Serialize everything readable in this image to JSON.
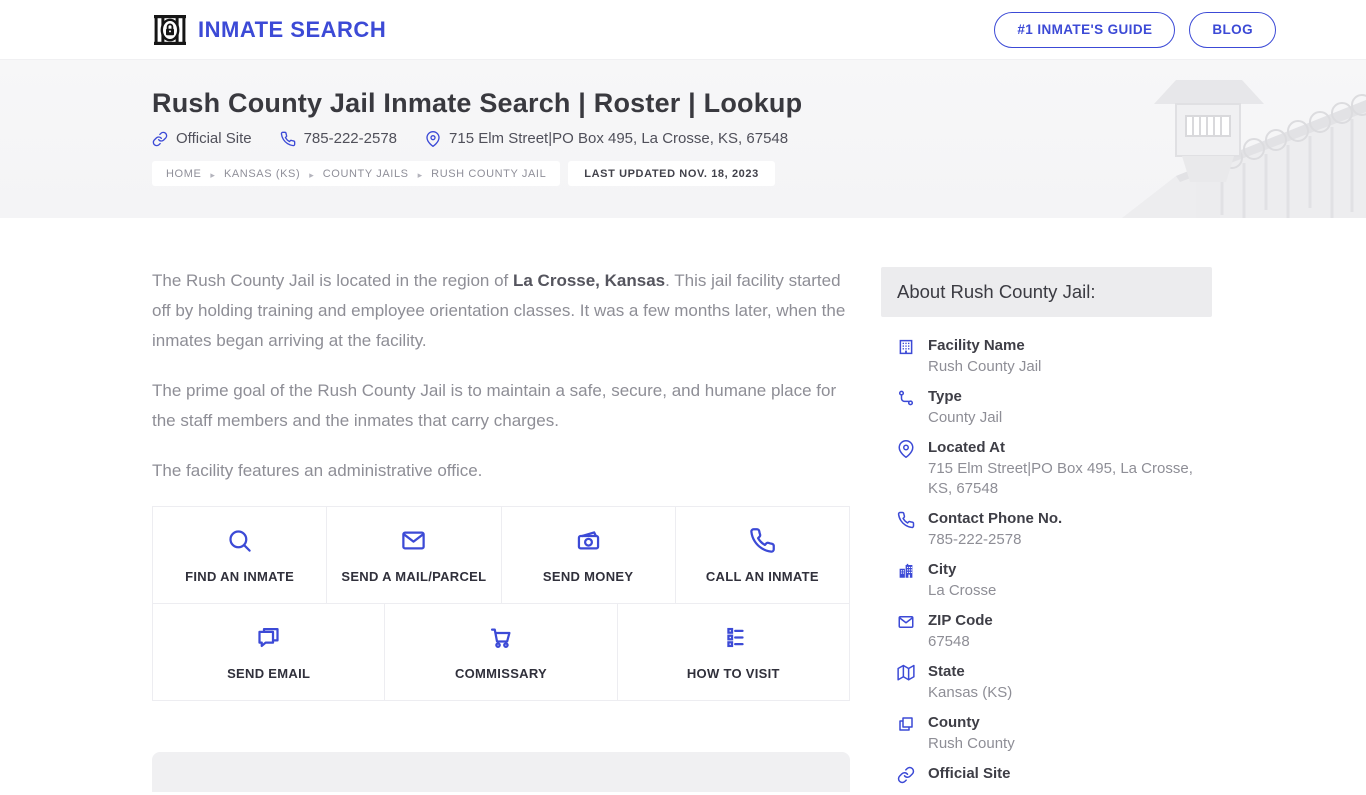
{
  "theme": {
    "accent": "#3c4ad6",
    "logo_black": "#161616",
    "hero_bg": "#f6f6f7",
    "text_gray": "#8e8e96",
    "heading_dark": "#39393f"
  },
  "header": {
    "logo_text": "INMATE SEARCH",
    "buttons": [
      {
        "label": "#1 INMATE'S GUIDE"
      },
      {
        "label": "BLOG"
      }
    ]
  },
  "hero": {
    "title": "Rush County Jail Inmate Search | Roster | Lookup",
    "meta": [
      {
        "icon": "link-icon",
        "text": "Official Site"
      },
      {
        "icon": "phone-icon",
        "text": "785-222-2578"
      },
      {
        "icon": "map-pin-icon",
        "text": "715 Elm Street|PO Box 495, La Crosse, KS, 67548"
      }
    ],
    "breadcrumb": [
      "HOME",
      "KANSAS (KS)",
      "COUNTY JAILS",
      "RUSH COUNTY JAIL"
    ],
    "last_updated": "LAST UPDATED NOV. 18, 2023"
  },
  "main": {
    "paragraphs": [
      {
        "pre": "The Rush County Jail is located in the region of ",
        "bold": "La Crosse, Kansas",
        "post": ". This jail facility started off by holding training and employee orientation classes. It was a few months later, when the inmates began arriving at the facility."
      },
      {
        "pre": "The prime goal of the Rush County Jail is to maintain a safe, secure, and humane place for the staff members and the inmates that carry charges.",
        "bold": "",
        "post": ""
      },
      {
        "pre": "The facility features an administrative office.",
        "bold": "",
        "post": ""
      }
    ],
    "actions_row1": [
      {
        "icon": "search-icon",
        "label": "FIND AN INMATE"
      },
      {
        "icon": "mail-icon",
        "label": "SEND A MAIL/PARCEL"
      },
      {
        "icon": "money-icon",
        "label": "SEND MONEY"
      },
      {
        "icon": "phone-icon",
        "label": "CALL AN INMATE"
      }
    ],
    "actions_row2": [
      {
        "icon": "chat-icon",
        "label": "SEND EMAIL"
      },
      {
        "icon": "cart-icon",
        "label": "COMMISSARY"
      },
      {
        "icon": "checklist-icon",
        "label": "HOW TO VISIT"
      }
    ]
  },
  "sidebar": {
    "title": "About Rush County Jail:",
    "items": [
      {
        "icon": "building-grid-icon",
        "label": "Facility Name",
        "value": "Rush County Jail"
      },
      {
        "icon": "route-icon",
        "label": "Type",
        "value": "County Jail"
      },
      {
        "icon": "map-pin-icon",
        "label": "Located At",
        "value": "715 Elm Street|PO Box 495, La Crosse, KS, 67548"
      },
      {
        "icon": "phone-icon",
        "label": "Contact Phone No.",
        "value": "785-222-2578"
      },
      {
        "icon": "city-building-icon",
        "label": "City",
        "value": "La Crosse"
      },
      {
        "icon": "envelope-icon",
        "label": "ZIP Code",
        "value": "67548"
      },
      {
        "icon": "map-icon",
        "label": "State",
        "value": "Kansas (KS)"
      },
      {
        "icon": "copy-icon",
        "label": "County",
        "value": "Rush County"
      },
      {
        "icon": "link-icon",
        "label": "Official Site",
        "value": ""
      }
    ]
  }
}
